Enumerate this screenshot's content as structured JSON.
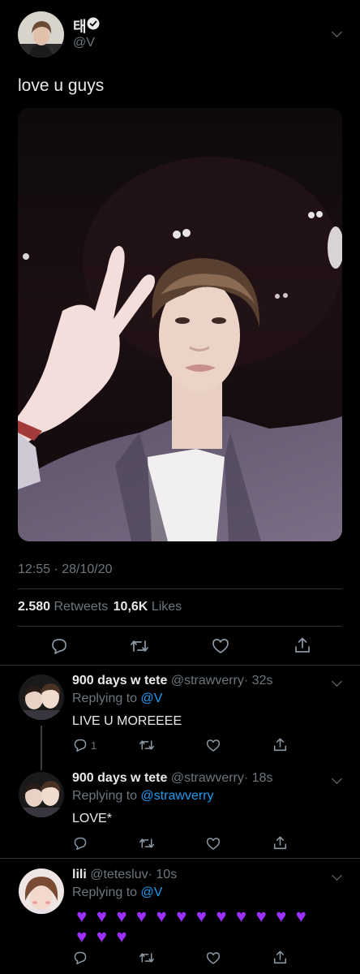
{
  "tweet": {
    "author_name": "태",
    "author_handle": "@V",
    "text": "love u guys",
    "timestamp": "12:55 · 28/10/20",
    "retweets_count": "2.580",
    "retweets_label": "Retweets",
    "likes_count": "10,6K",
    "likes_label": "Likes"
  },
  "replies": [
    {
      "name": "900 days w tete",
      "handle": "@strawverry",
      "time": "· 32s",
      "replying_label": "Replying to",
      "replying_to": "@V",
      "text": "LIVE U MOREEEE",
      "reply_count": "1"
    },
    {
      "name": "900 days w tete",
      "handle": "@strawverry",
      "time": "· 18s",
      "replying_label": "Replying to",
      "replying_to": "@strawverry",
      "text": "LOVE*"
    },
    {
      "name": "lili",
      "handle": "@tetesluv",
      "time": "· 10s",
      "replying_label": "Replying to",
      "replying_to": "@V",
      "text": "💜💜💜💜💜💜💜💜💜💜💜💜💜💜💜"
    }
  ],
  "colors": {
    "accent": "#1d9bf0",
    "background": "#000000",
    "heart": "#9b30ff"
  }
}
